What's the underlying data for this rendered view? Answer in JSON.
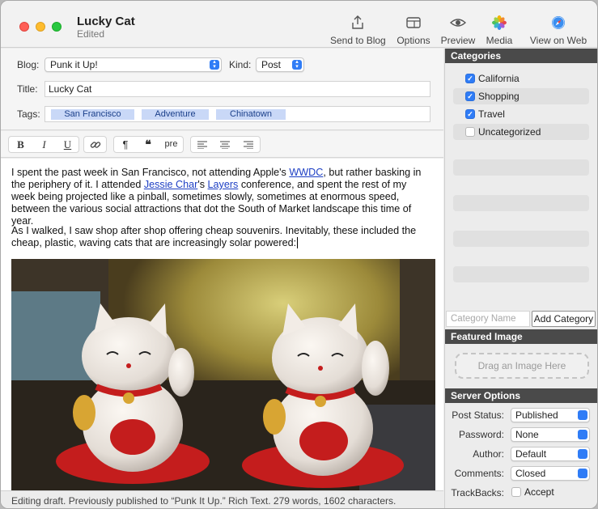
{
  "window": {
    "title": "Lucky Cat",
    "subtitle": "Edited"
  },
  "toolbar": {
    "send_label": "Send to Blog",
    "options_label": "Options",
    "preview_label": "Preview",
    "media_label": "Media",
    "view_web_label": "View on Web"
  },
  "meta": {
    "blog_label": "Blog:",
    "blog_value": "Punk it Up!",
    "kind_label": "Kind:",
    "kind_value": "Post",
    "title_label": "Title:",
    "title_value": "Lucky Cat",
    "tags_label": "Tags:",
    "tags": [
      "San Francisco",
      "Adventure",
      "Chinatown"
    ]
  },
  "format_bar": {
    "bold": "B",
    "italic": "I",
    "underline": "U",
    "paragraph": "¶",
    "quote": "❝",
    "pre": "pre"
  },
  "editor": {
    "p1_a": "I spent the past week in San Francisco, not attending Apple's ",
    "p1_link1": "WWDC",
    "p1_b": ", but rather basking in the periphery of it. I attended ",
    "p1_link2": "Jessie Char",
    "p1_c": "'s ",
    "p1_link3": "Layers",
    "p1_d": " conference, and spent the rest of my week being projected like a pinball, sometimes slowly, sometimes at enormous speed, between the various social attractions that dot the South of Market landscape this time of year.",
    "p2": "As I walked, I saw shop after shop offering cheap souvenirs. Inevitably, these included the cheap, plastic, waving cats that are increasingly solar powered:"
  },
  "status": {
    "text": "Editing draft. Previously published to “Punk It Up.” Rich Text. 279 words, 1602 characters."
  },
  "categories": {
    "header": "Categories",
    "items": [
      {
        "label": "California",
        "checked": true
      },
      {
        "label": "Shopping",
        "checked": true
      },
      {
        "label": "Travel",
        "checked": true
      },
      {
        "label": "Uncategorized",
        "checked": false
      }
    ],
    "input_placeholder": "Category Name",
    "add_label": "Add Category"
  },
  "featured": {
    "header": "Featured Image",
    "drop_label": "Drag an Image Here"
  },
  "server": {
    "header": "Server Options",
    "post_status_label": "Post Status:",
    "post_status_value": "Published",
    "password_label": "Password:",
    "password_value": "None",
    "author_label": "Author:",
    "author_value": "Default",
    "comments_label": "Comments:",
    "comments_value": "Closed",
    "trackbacks_label": "TrackBacks:",
    "trackbacks_value": "Accept"
  },
  "colors": {
    "accent": "#2f7cf6",
    "section_header": "#4a4a4a",
    "tag_bg": "#c9d8f7",
    "link": "#1d3fc4"
  }
}
